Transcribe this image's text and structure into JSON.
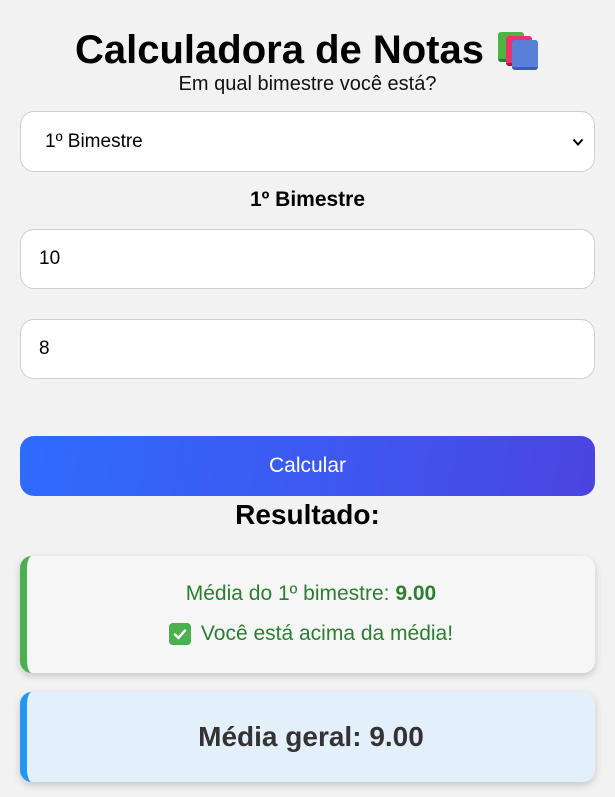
{
  "header": {
    "title": "Calculadora de Notas",
    "title_icon": "books-icon",
    "subtitle": "Em qual bimestre você está?"
  },
  "bimester_select": {
    "selected": "1º Bimestre",
    "icon": "chevron-down-icon"
  },
  "section": {
    "label": "1º Bimestre"
  },
  "inputs": {
    "grade_1": "10",
    "grade_2": "8"
  },
  "calculate_button": {
    "label": "Calcular",
    "colors": [
      "#2f6bff",
      "#4b44e0"
    ]
  },
  "result": {
    "heading": "Resultado:",
    "average_label": "Média do 1º bimestre: ",
    "average_value": "9.00",
    "status_icon": "check-box-icon",
    "status_text": "Você está acima da média!",
    "accent_color": "#4caf50",
    "text_color": "#2e7d32"
  },
  "overall": {
    "label": "Média geral: ",
    "value": "9.00",
    "accent_color": "#2196f3"
  }
}
